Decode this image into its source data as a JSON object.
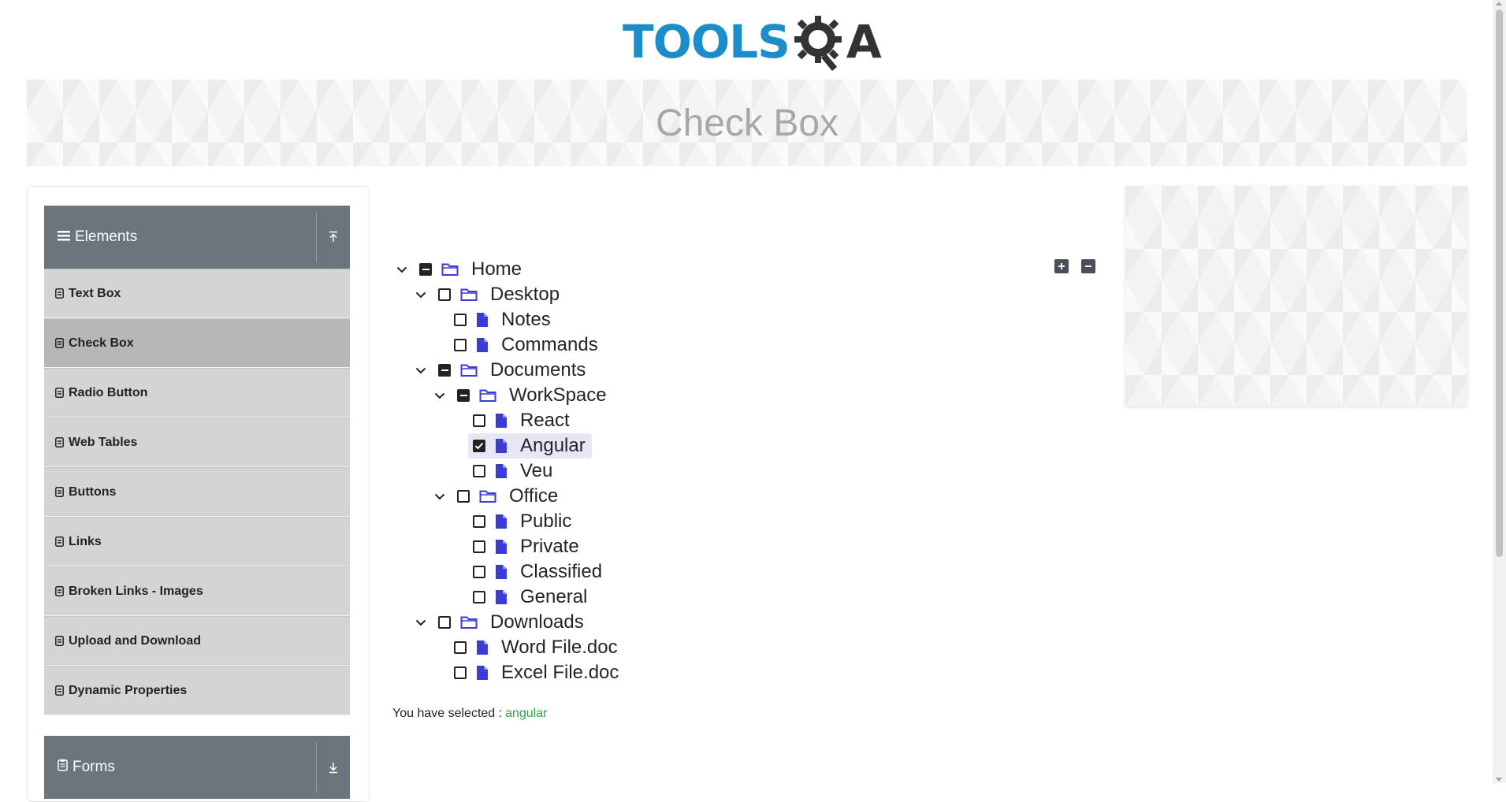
{
  "brand": {
    "logo_text": "TOOLS",
    "logo_suffix": "A",
    "logo_colors": {
      "primary": "#1c8dc8",
      "dark": "#333333"
    }
  },
  "page": {
    "title": "Check Box"
  },
  "sidebar": {
    "elements_group": {
      "label": "Elements",
      "icon": "hamburger-icon",
      "toggle_icon": "collapse-up-icon"
    },
    "items": [
      {
        "label": "Text Box"
      },
      {
        "label": "Check Box",
        "active": true
      },
      {
        "label": "Radio Button"
      },
      {
        "label": "Web Tables"
      },
      {
        "label": "Buttons"
      },
      {
        "label": "Links"
      },
      {
        "label": "Broken Links - Images"
      },
      {
        "label": "Upload and Download"
      },
      {
        "label": "Dynamic Properties"
      }
    ],
    "forms_group": {
      "label": "Forms",
      "icon": "clipboard-icon",
      "toggle_icon": "expand-down-icon"
    }
  },
  "tree": {
    "nodes": [
      {
        "label": "Home",
        "type": "folder",
        "state": "partial"
      },
      {
        "label": "Desktop",
        "type": "folder",
        "state": "unchecked"
      },
      {
        "label": "Notes",
        "type": "file",
        "state": "unchecked"
      },
      {
        "label": "Commands",
        "type": "file",
        "state": "unchecked"
      },
      {
        "label": "Documents",
        "type": "folder",
        "state": "partial"
      },
      {
        "label": "WorkSpace",
        "type": "folder",
        "state": "partial"
      },
      {
        "label": "React",
        "type": "file",
        "state": "unchecked"
      },
      {
        "label": "Angular",
        "type": "file",
        "state": "checked"
      },
      {
        "label": "Veu",
        "type": "file",
        "state": "unchecked"
      },
      {
        "label": "Office",
        "type": "folder",
        "state": "unchecked"
      },
      {
        "label": "Public",
        "type": "file",
        "state": "unchecked"
      },
      {
        "label": "Private",
        "type": "file",
        "state": "unchecked"
      },
      {
        "label": "Classified",
        "type": "file",
        "state": "unchecked"
      },
      {
        "label": "General",
        "type": "file",
        "state": "unchecked"
      },
      {
        "label": "Downloads",
        "type": "folder",
        "state": "unchecked"
      },
      {
        "label": "Word File.doc",
        "type": "file",
        "state": "unchecked"
      },
      {
        "label": "Excel File.doc",
        "type": "file",
        "state": "unchecked"
      }
    ],
    "expand_all_icon": "plus-square-icon",
    "collapse_all_icon": "minus-square-icon"
  },
  "result": {
    "prefix": "You have selected :",
    "value": "angular"
  },
  "colors": {
    "accent_icon": "#3b3bd6",
    "success": "#28a745",
    "sidebar_header": "#6c757d",
    "menu_bg": "#d4d4d4",
    "menu_active_bg": "#b7b7b7"
  }
}
